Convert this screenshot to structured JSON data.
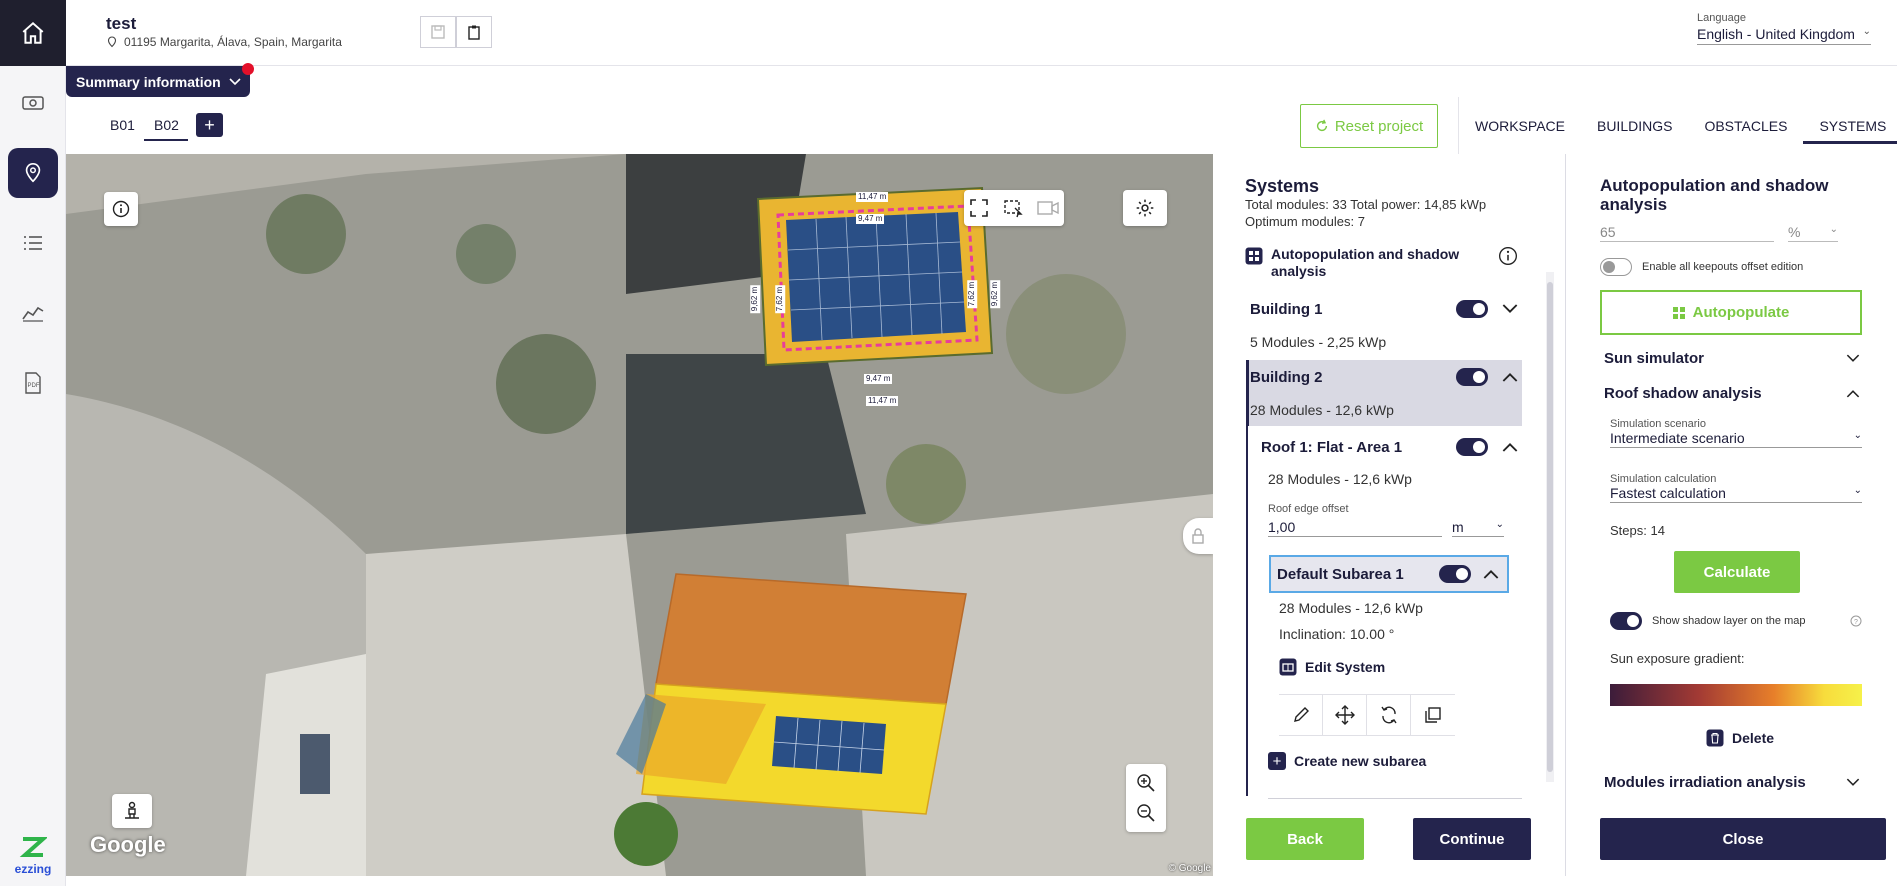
{
  "header": {
    "project_title": "test",
    "address": "01195 Margarita, Álava, Spain, Margarita",
    "language_label": "Language",
    "language_value": "English - United Kingdom"
  },
  "summary": {
    "label": "Summary information"
  },
  "building_tabs": [
    {
      "label": "B01"
    },
    {
      "label": "B02"
    }
  ],
  "toolbar": {
    "reset_label": "Reset project"
  },
  "nav_tabs": [
    {
      "label": "WORKSPACE"
    },
    {
      "label": "BUILDINGS"
    },
    {
      "label": "OBSTACLES"
    },
    {
      "label": "SYSTEMS"
    }
  ],
  "map": {
    "google_label": "Google",
    "copyright": "© Google",
    "measurements": {
      "top_outer": "11,47 m",
      "top_inner": "9,47 m",
      "bottom_inner": "9,47 m",
      "bottom_outer": "11,47 m",
      "left_outer": "9,62 m",
      "left_inner": "7,62 m",
      "right_inner": "7,62 m",
      "right_outer": "9,62 m"
    }
  },
  "systems": {
    "title": "Systems",
    "totals": "Total modules: 33 Total power: 14,85 kWp",
    "optimum": "Optimum modules: 7",
    "autopop_label": "Autopopulation and shadow analysis",
    "building1": {
      "label": "Building 1",
      "detail": "5 Modules - 2,25 kWp"
    },
    "building2": {
      "label": "Building 2",
      "detail": "28 Modules - 12,6 kWp"
    },
    "roof1": {
      "label": "Roof 1: Flat - Area 1",
      "detail": "28 Modules - 12,6 kWp"
    },
    "roof_edge_label": "Roof edge offset",
    "roof_edge_value": "1,00",
    "roof_edge_unit": "m",
    "subarea": {
      "label": "Default Subarea 1",
      "detail": "28 Modules - 12,6 kWp",
      "inclination": "Inclination: 10.00 °"
    },
    "edit_system": "Edit System",
    "create_subarea": "Create new subarea",
    "back": "Back",
    "continue": "Continue"
  },
  "auto_panel": {
    "title": "Autopopulation and shadow analysis",
    "partial_value": "65",
    "partial_unit": "%",
    "keepouts_label": "Enable all keepouts offset edition",
    "autopopulate": "Autopopulate",
    "sun_simulator": "Sun simulator",
    "roof_shadow": "Roof shadow analysis",
    "scenario_label": "Simulation scenario",
    "scenario_value": "Intermediate scenario",
    "calc_label": "Simulation calculation",
    "calc_value": "Fastest calculation",
    "steps": "Steps: 14",
    "calculate": "Calculate",
    "show_shadow": "Show shadow layer on the map",
    "gradient_label": "Sun exposure gradient:",
    "delete": "Delete",
    "irradiation": "Modules irradiation analysis",
    "close": "Close"
  },
  "colors": {
    "primary": "#24244d",
    "accent_green": "#7bc943",
    "selected_row": "#d9d9e3"
  },
  "logo": {
    "text": "ezzing"
  }
}
